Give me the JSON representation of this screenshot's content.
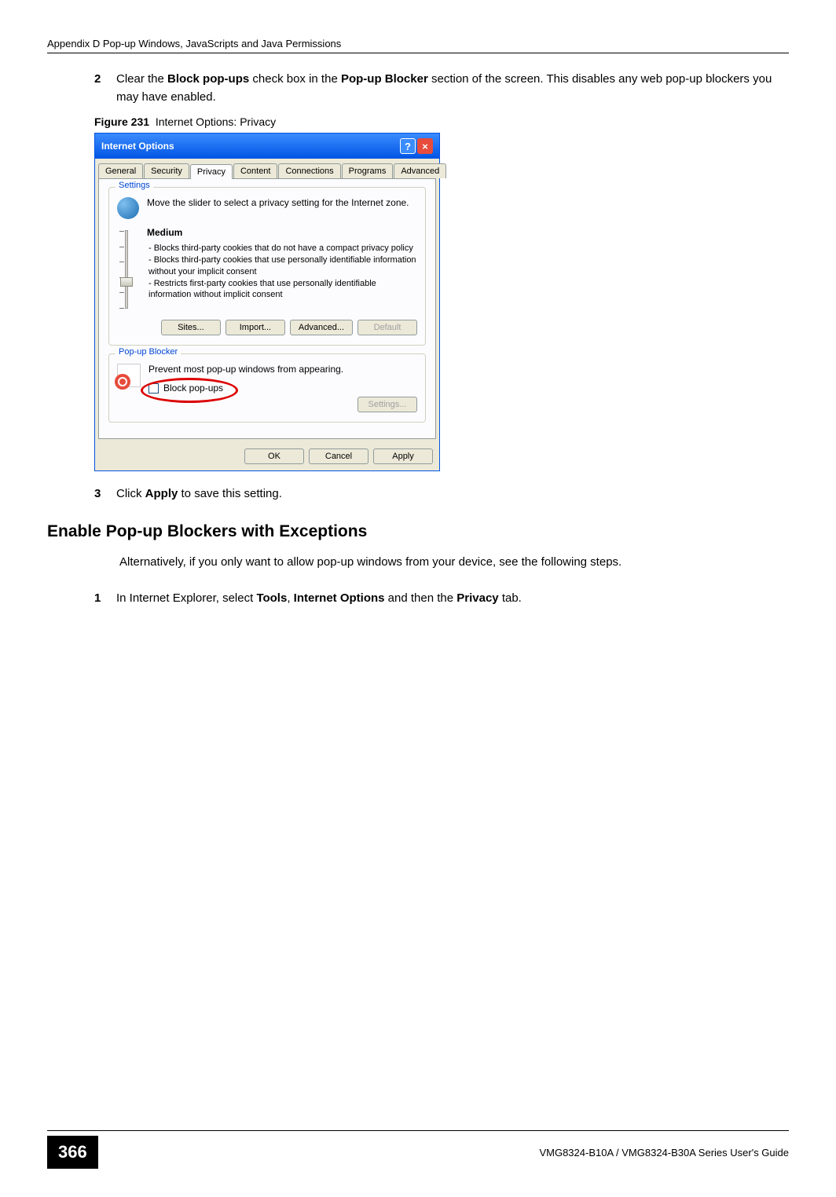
{
  "header": {
    "appendix_title": "Appendix D Pop-up Windows, JavaScripts and Java Permissions"
  },
  "steps": {
    "s2_num": "2",
    "s2_text_pre": "Clear the ",
    "s2_bold1": "Block pop-ups",
    "s2_text_mid": " check box in the ",
    "s2_bold2": "Pop-up Blocker",
    "s2_text_post": " section of the screen. This disables any web pop-up blockers you may have enabled.",
    "s3_num": "3",
    "s3_text_pre": "Click ",
    "s3_bold": "Apply",
    "s3_text_post": " to save this setting."
  },
  "figure": {
    "label": "Figure 231",
    "caption": "Internet Options: Privacy"
  },
  "dialog": {
    "title": "Internet Options",
    "tabs": [
      "General",
      "Security",
      "Privacy",
      "Content",
      "Connections",
      "Programs",
      "Advanced"
    ],
    "settings_group": "Settings",
    "settings_intro": "Move the slider to select a privacy setting for the Internet zone.",
    "level": "Medium",
    "bullets": [
      "- Blocks third-party cookies that do not have a compact privacy policy",
      "- Blocks third-party cookies that use personally identifiable information without your implicit consent",
      "- Restricts first-party cookies that use personally identifiable information without implicit consent"
    ],
    "btn_sites": "Sites...",
    "btn_import": "Import...",
    "btn_advanced": "Advanced...",
    "btn_default": "Default",
    "popup_group": "Pop-up Blocker",
    "popup_intro": "Prevent most pop-up windows from appearing.",
    "cb_label": "Block pop-ups",
    "btn_settings": "Settings...",
    "btn_ok": "OK",
    "btn_cancel": "Cancel",
    "btn_apply": "Apply"
  },
  "section": {
    "heading": "Enable Pop-up Blockers with Exceptions",
    "para": "Alternatively, if you only want to allow pop-up windows from your device, see the following steps.",
    "s1_num": "1",
    "s1_pre": "In Internet Explorer, select ",
    "s1_b1": "Tools",
    "s1_mid1": ", ",
    "s1_b2": "Internet Options",
    "s1_mid2": " and then the ",
    "s1_b3": "Privacy",
    "s1_post": " tab."
  },
  "footer": {
    "page": "366",
    "guide": "VMG8324-B10A / VMG8324-B30A Series User's Guide"
  }
}
